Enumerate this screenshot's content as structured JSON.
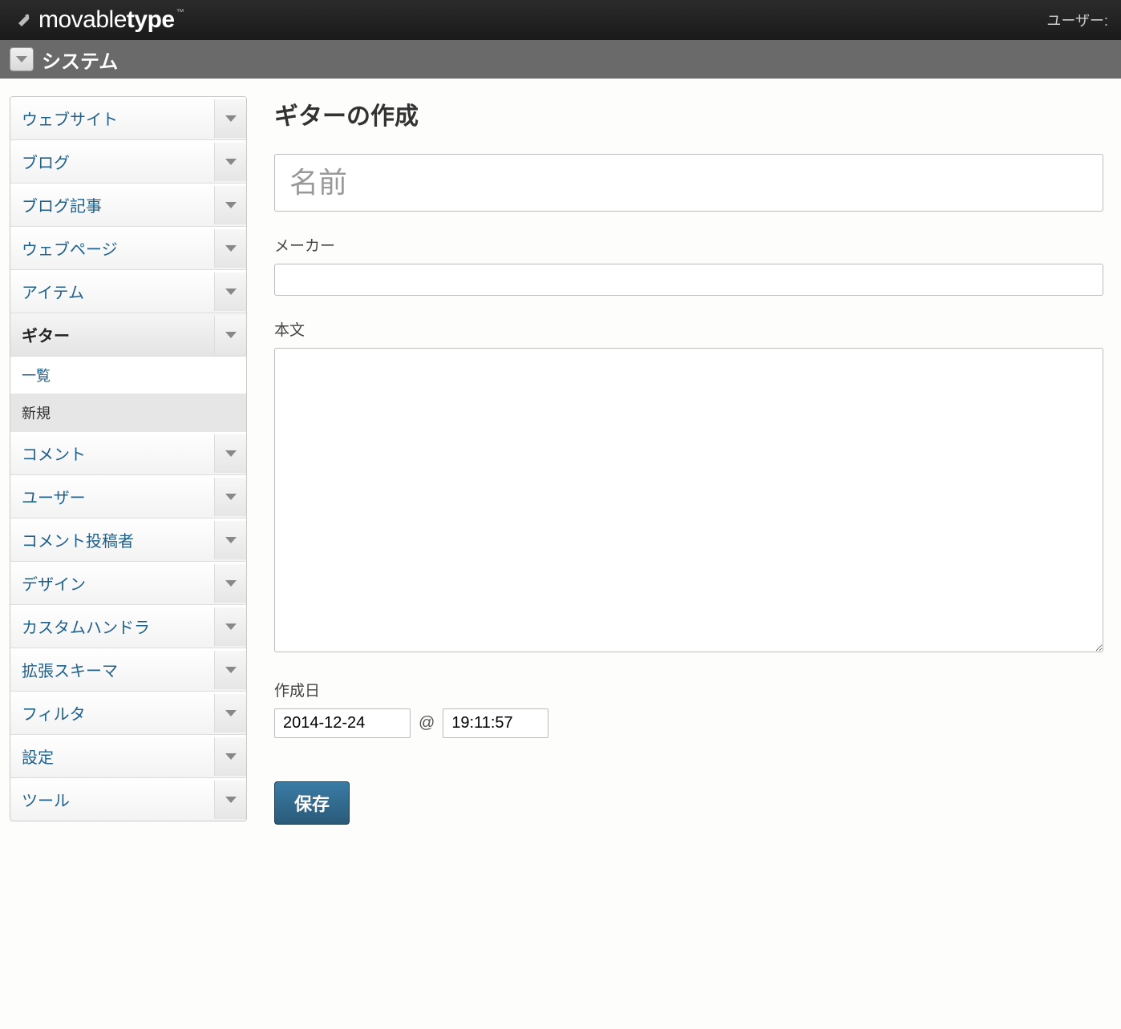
{
  "topbar": {
    "brand_movable": "movable",
    "brand_type": "type",
    "brand_tm": "™",
    "user_label": "ユーザー:"
  },
  "scopebar": {
    "label": "システム"
  },
  "sidebar": {
    "items": [
      {
        "id": "website",
        "label": "ウェブサイト",
        "has_chevron": true
      },
      {
        "id": "blog",
        "label": "ブログ",
        "has_chevron": true
      },
      {
        "id": "entry",
        "label": "ブログ記事",
        "has_chevron": true
      },
      {
        "id": "page",
        "label": "ウェブページ",
        "has_chevron": true
      },
      {
        "id": "item",
        "label": "アイテム",
        "has_chevron": true
      },
      {
        "id": "guitar",
        "label": "ギター",
        "has_chevron": true,
        "active": true,
        "sub": [
          {
            "id": "list",
            "label": "一覧"
          },
          {
            "id": "new",
            "label": "新規",
            "selected": true
          }
        ]
      },
      {
        "id": "comment",
        "label": "コメント",
        "has_chevron": true
      },
      {
        "id": "user",
        "label": "ユーザー",
        "has_chevron": true
      },
      {
        "id": "commenter",
        "label": "コメント投稿者",
        "has_chevron": true
      },
      {
        "id": "design",
        "label": "デザイン",
        "has_chevron": true
      },
      {
        "id": "custom-handler",
        "label": "カスタムハンドラ",
        "has_chevron": true
      },
      {
        "id": "ext-schema",
        "label": "拡張スキーマ",
        "has_chevron": true
      },
      {
        "id": "filter",
        "label": "フィルタ",
        "has_chevron": true
      },
      {
        "id": "settings",
        "label": "設定",
        "has_chevron": true
      },
      {
        "id": "tools",
        "label": "ツール",
        "has_chevron": true
      }
    ]
  },
  "main": {
    "page_title": "ギターの作成",
    "name_placeholder": "名前",
    "maker_label": "メーカー",
    "body_label": "本文",
    "created_label": "作成日",
    "date_value": "2014-12-24",
    "at_symbol": "@",
    "time_value": "19:11:57",
    "save_label": "保存"
  }
}
